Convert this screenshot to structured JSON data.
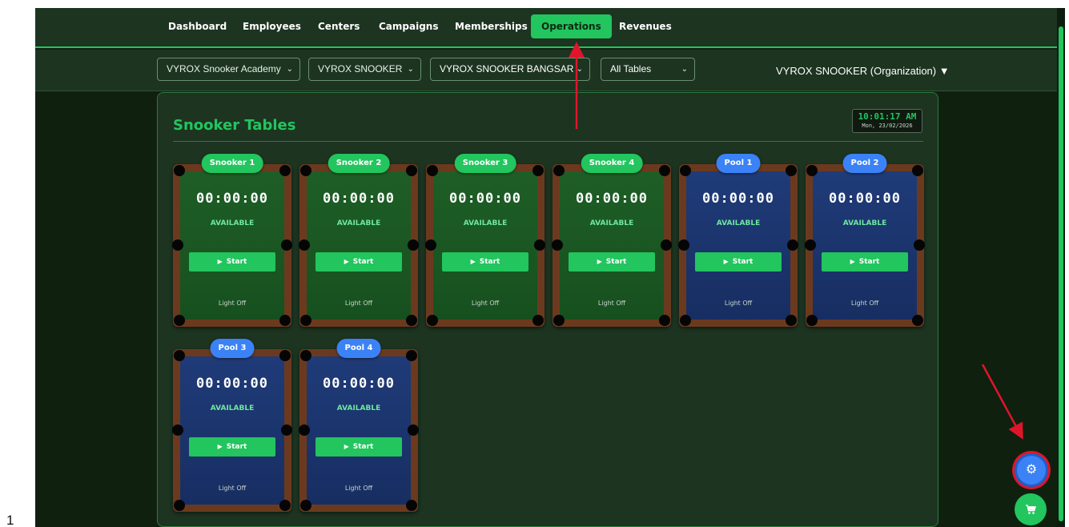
{
  "nav": {
    "tabs": [
      {
        "label": "Dashboard"
      },
      {
        "label": "Employees"
      },
      {
        "label": "Centers"
      },
      {
        "label": "Campaigns"
      },
      {
        "label": "Memberships"
      },
      {
        "label": "Operations",
        "active": true
      },
      {
        "label": "Revenues"
      }
    ]
  },
  "filters": {
    "academy": "VYROX Snooker Academy",
    "brand": "VYROX SNOOKER",
    "branch": "VYROX SNOOKER BANGSAR",
    "tables": "All Tables",
    "organization": "VYROX SNOOKER (Organization) ▼"
  },
  "panel": {
    "title": "Snooker Tables",
    "clock_time": "10:01:17 AM",
    "clock_date": "Mon, 23/02/2026"
  },
  "tables": [
    {
      "name": "Snooker 1",
      "kind": "snooker",
      "timer": "00:00:00",
      "status": "AVAILABLE",
      "button": "Start",
      "light": "Light Off"
    },
    {
      "name": "Snooker 2",
      "kind": "snooker",
      "timer": "00:00:00",
      "status": "AVAILABLE",
      "button": "Start",
      "light": "Light Off"
    },
    {
      "name": "Snooker 3",
      "kind": "snooker",
      "timer": "00:00:00",
      "status": "AVAILABLE",
      "button": "Start",
      "light": "Light Off"
    },
    {
      "name": "Snooker 4",
      "kind": "snooker",
      "timer": "00:00:00",
      "status": "AVAILABLE",
      "button": "Start",
      "light": "Light Off"
    },
    {
      "name": "Pool 1",
      "kind": "pool",
      "timer": "00:00:00",
      "status": "AVAILABLE",
      "button": "Start",
      "light": "Light Off"
    },
    {
      "name": "Pool 2",
      "kind": "pool",
      "timer": "00:00:00",
      "status": "AVAILABLE",
      "button": "Start",
      "light": "Light Off"
    },
    {
      "name": "Pool 3",
      "kind": "pool",
      "timer": "00:00:00",
      "status": "AVAILABLE",
      "button": "Start",
      "light": "Light Off"
    },
    {
      "name": "Pool 4",
      "kind": "pool",
      "timer": "00:00:00",
      "status": "AVAILABLE",
      "button": "Start",
      "light": "Light Off"
    }
  ],
  "floating": {
    "settings_icon": "gear-icon",
    "cart_icon": "cart-icon"
  },
  "page_marker": "1",
  "colors": {
    "accent": "#22c55e",
    "pool": "#3b82f6",
    "background": "#10200f",
    "annotation": "#e0152a"
  }
}
